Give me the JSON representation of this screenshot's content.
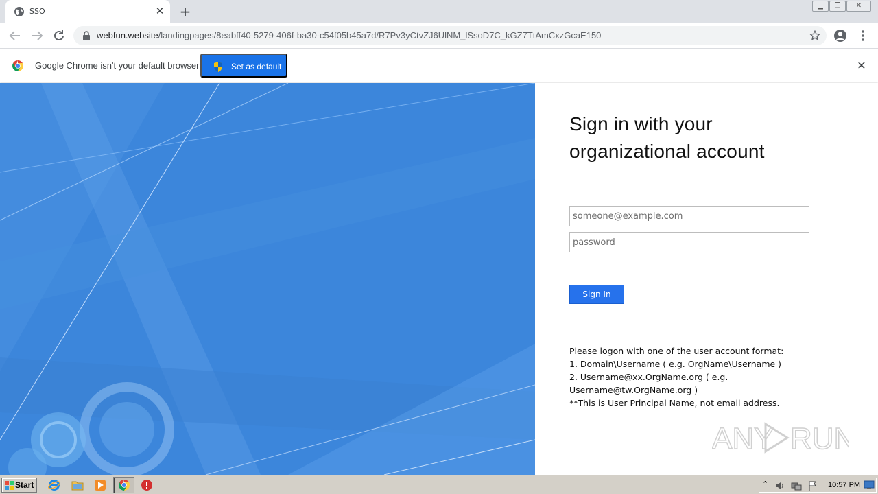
{
  "browser": {
    "tab": {
      "title": "SSO",
      "favicon": "globe-icon"
    },
    "url": {
      "host": "webfun.website",
      "path": "/landingpages/8eabff40-5279-406f-ba30-c54f05b45a7d/R7Pv3yCtvZJ6UlNM_lSsoD7C_kGZ7TtAmCxzGcaE150"
    },
    "infobar": {
      "message": "Google Chrome isn't your default browser",
      "button_label": "Set as default"
    }
  },
  "login": {
    "title_line1": "Sign in with your",
    "title_line2": "organizational account",
    "username_placeholder": "someone@example.com",
    "password_placeholder": "password",
    "signin_label": "Sign In",
    "help_lines": [
      "Please logon with one of the user account format:",
      "1. Domain\\Username ( e.g. OrgName\\Username )",
      "2. Username@xx.OrgName.org ( e.g.",
      "Username@tw.OrgName.org )",
      "**This is User Principal Name, not email address."
    ]
  },
  "watermark": "ANY RUN",
  "taskbar": {
    "start_label": "Start",
    "clock": "10:57 PM"
  },
  "colors": {
    "accent": "#1a73e8",
    "signin_button": "#2672ec",
    "illustration_bg": "#3c86db"
  }
}
